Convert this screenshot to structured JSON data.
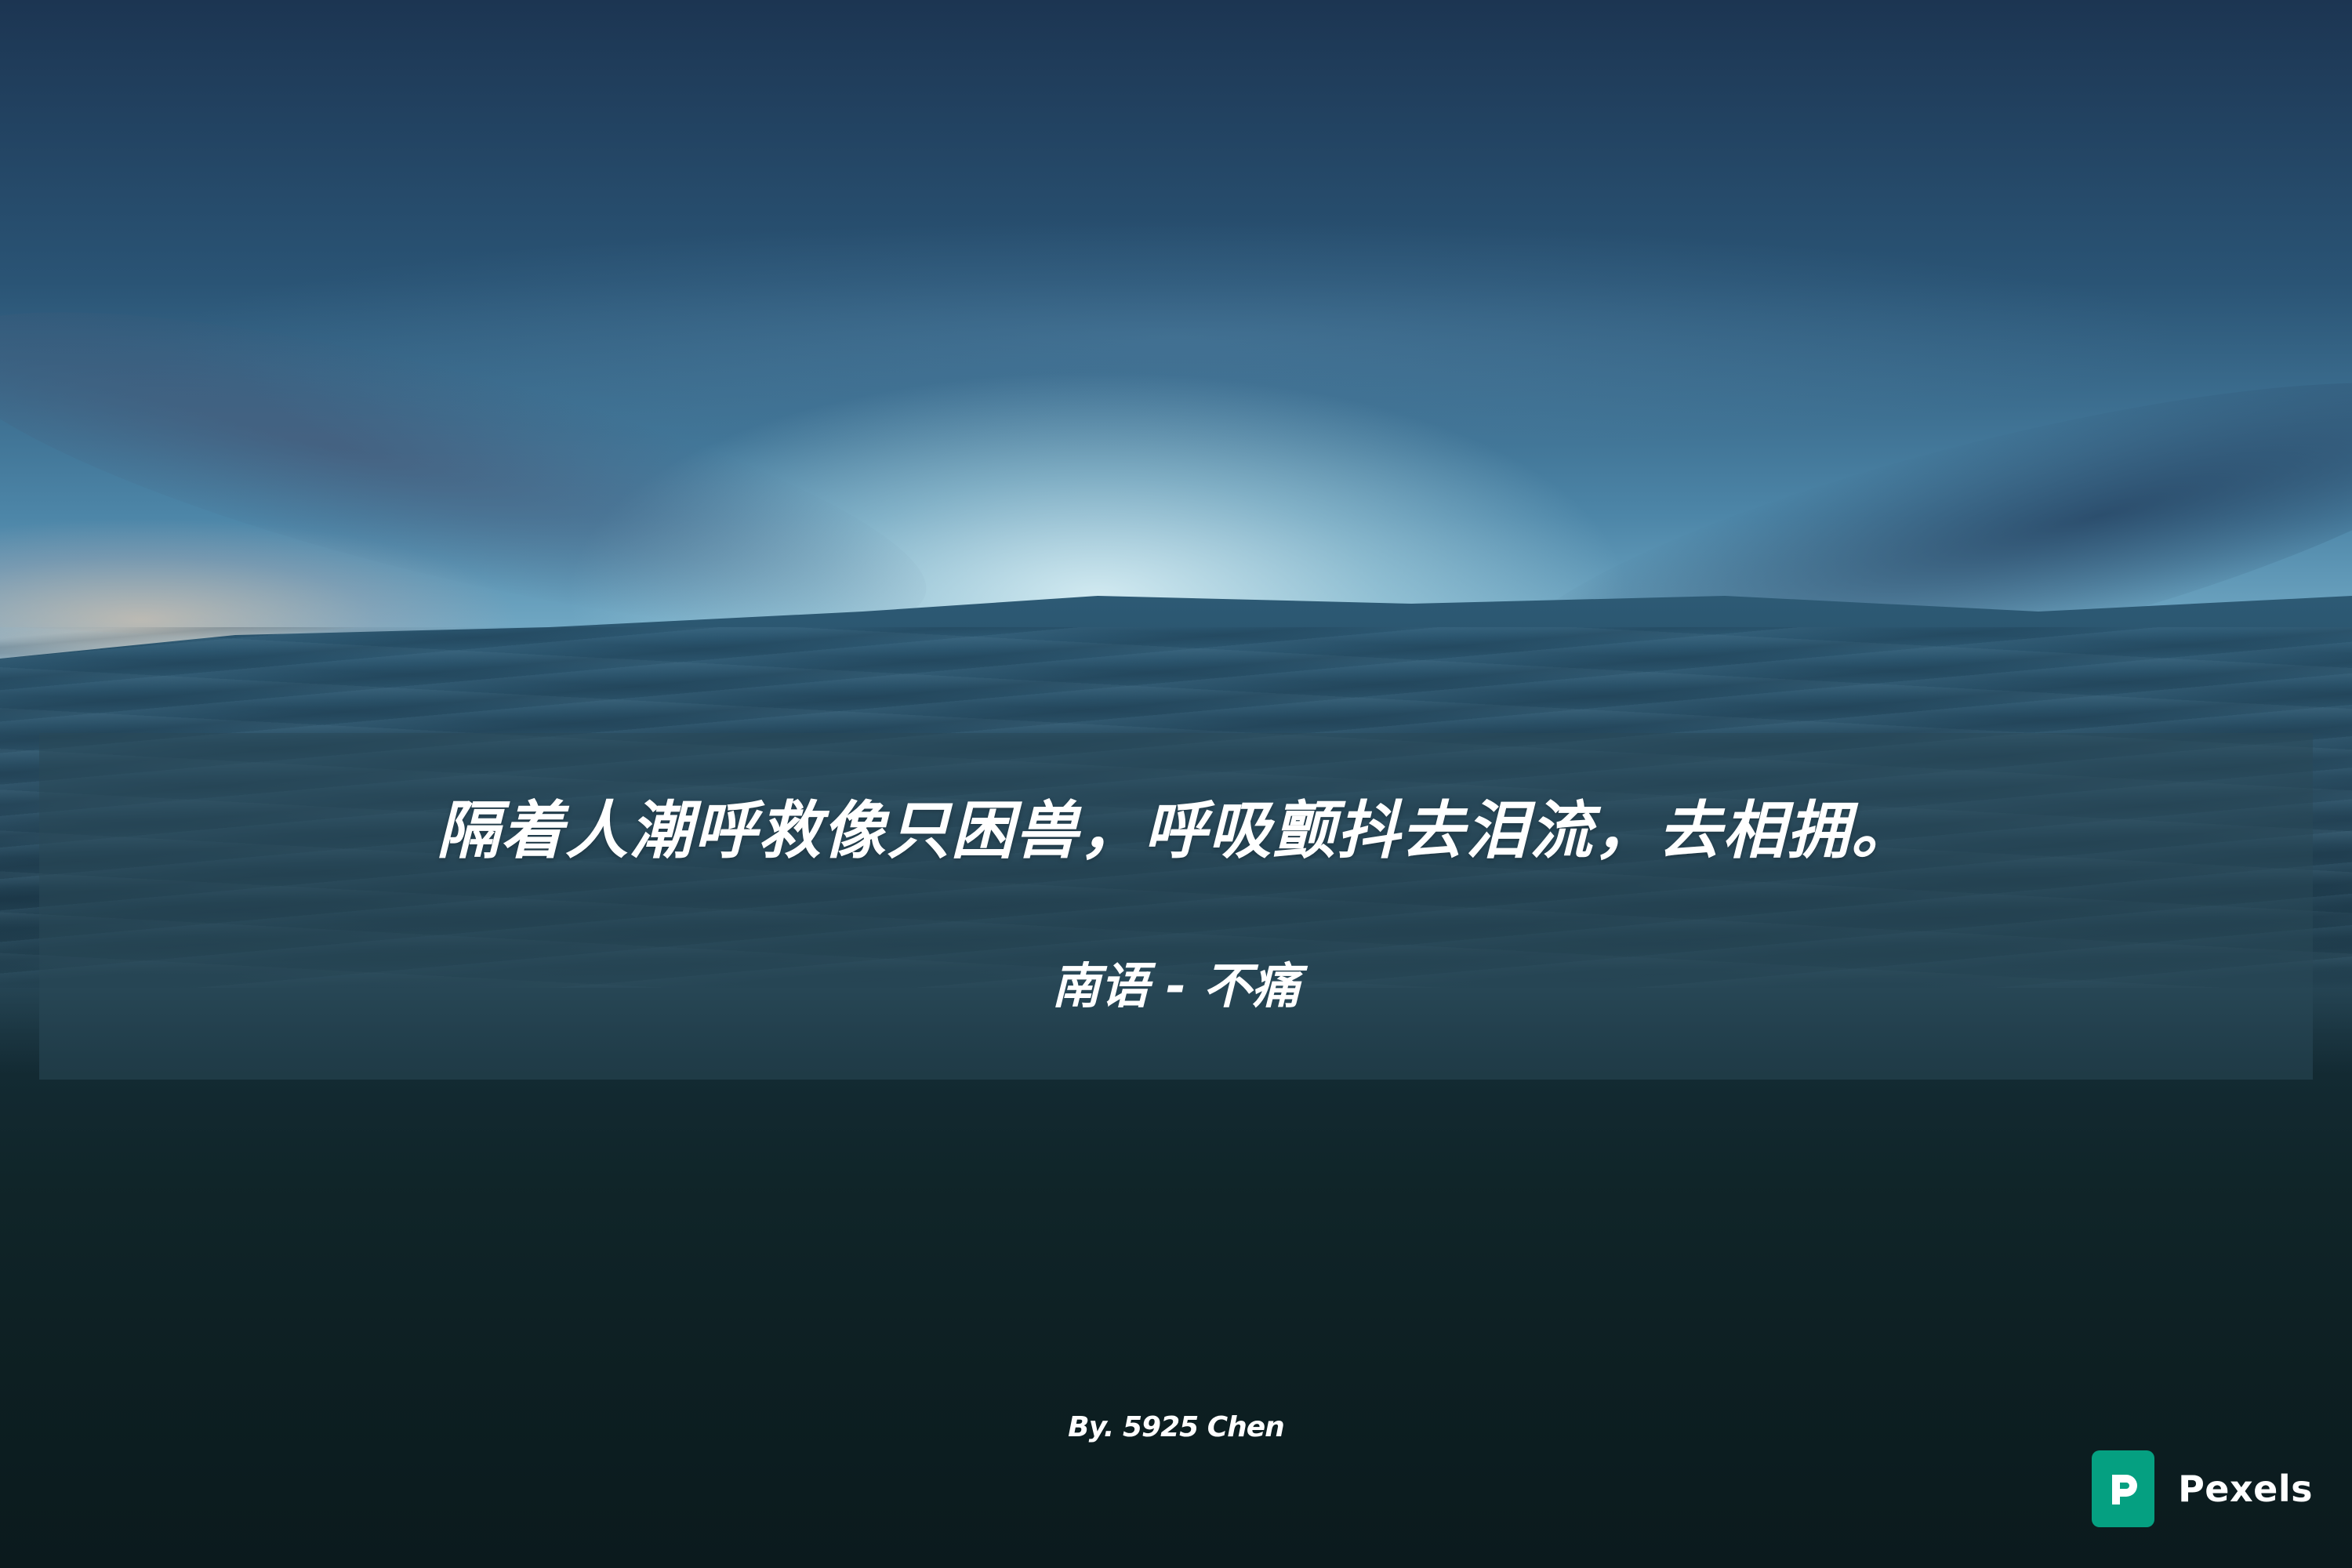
{
  "quote": {
    "text": "隔着人潮呼救像只困兽，呼吸颤抖去泪流，去相拥。",
    "attribution": "南语 - 不痛"
  },
  "byline": "By. 5925 Chen",
  "watermark": {
    "name": "Pexels",
    "icon": "pexels-logo-icon",
    "color": "#05a081"
  },
  "colors": {
    "sky_top": "#1c3552",
    "horizon_glow": "#bfe2ec",
    "sea_deep": "#0b1a1d",
    "panel": "#2a4858"
  }
}
